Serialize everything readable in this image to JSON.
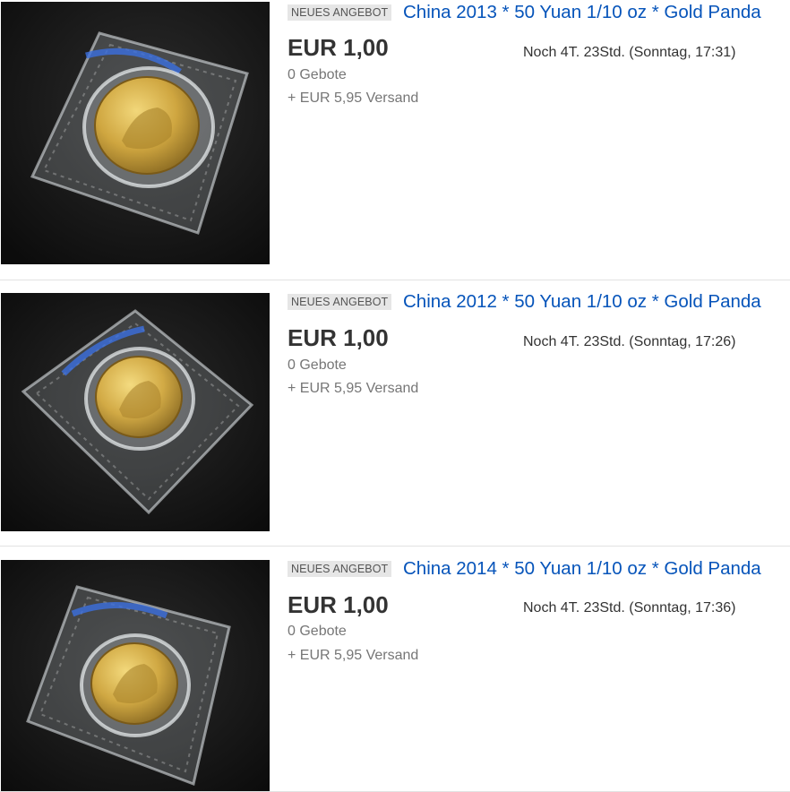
{
  "listings": [
    {
      "badge": "NEUES ANGEBOT",
      "title": "China 2013 * 50 Yuan 1/10 oz * Gold Panda",
      "price": "EUR 1,00",
      "bids": "0 Gebote",
      "shipping": "+ EUR 5,95 Versand",
      "time_left": "Noch 4T. 23Std. (Sonntag, 17:31)",
      "image": "gold-panda-coin-photo"
    },
    {
      "badge": "NEUES ANGEBOT",
      "title": "China 2012 * 50 Yuan 1/10 oz * Gold Panda",
      "price": "EUR 1,00",
      "bids": "0 Gebote",
      "shipping": "+ EUR 5,95 Versand",
      "time_left": "Noch 4T. 23Std. (Sonntag, 17:26)",
      "image": "gold-panda-coin-photo"
    },
    {
      "badge": "NEUES ANGEBOT",
      "title": "China 2014 * 50 Yuan 1/10 oz * Gold Panda",
      "price": "EUR 1,00",
      "bids": "0 Gebote",
      "shipping": "+ EUR 5,95 Versand",
      "time_left": "Noch 4T. 23Std. (Sonntag, 17:36)",
      "image": "gold-panda-coin-photo"
    }
  ],
  "colors": {
    "link": "#0654ba",
    "badge_bg": "#e6e6e6",
    "price": "#333333",
    "muted": "#767676",
    "divider": "#e2e2e2",
    "photo_bg": "#141414",
    "coin_gold": "#c9a23a"
  }
}
